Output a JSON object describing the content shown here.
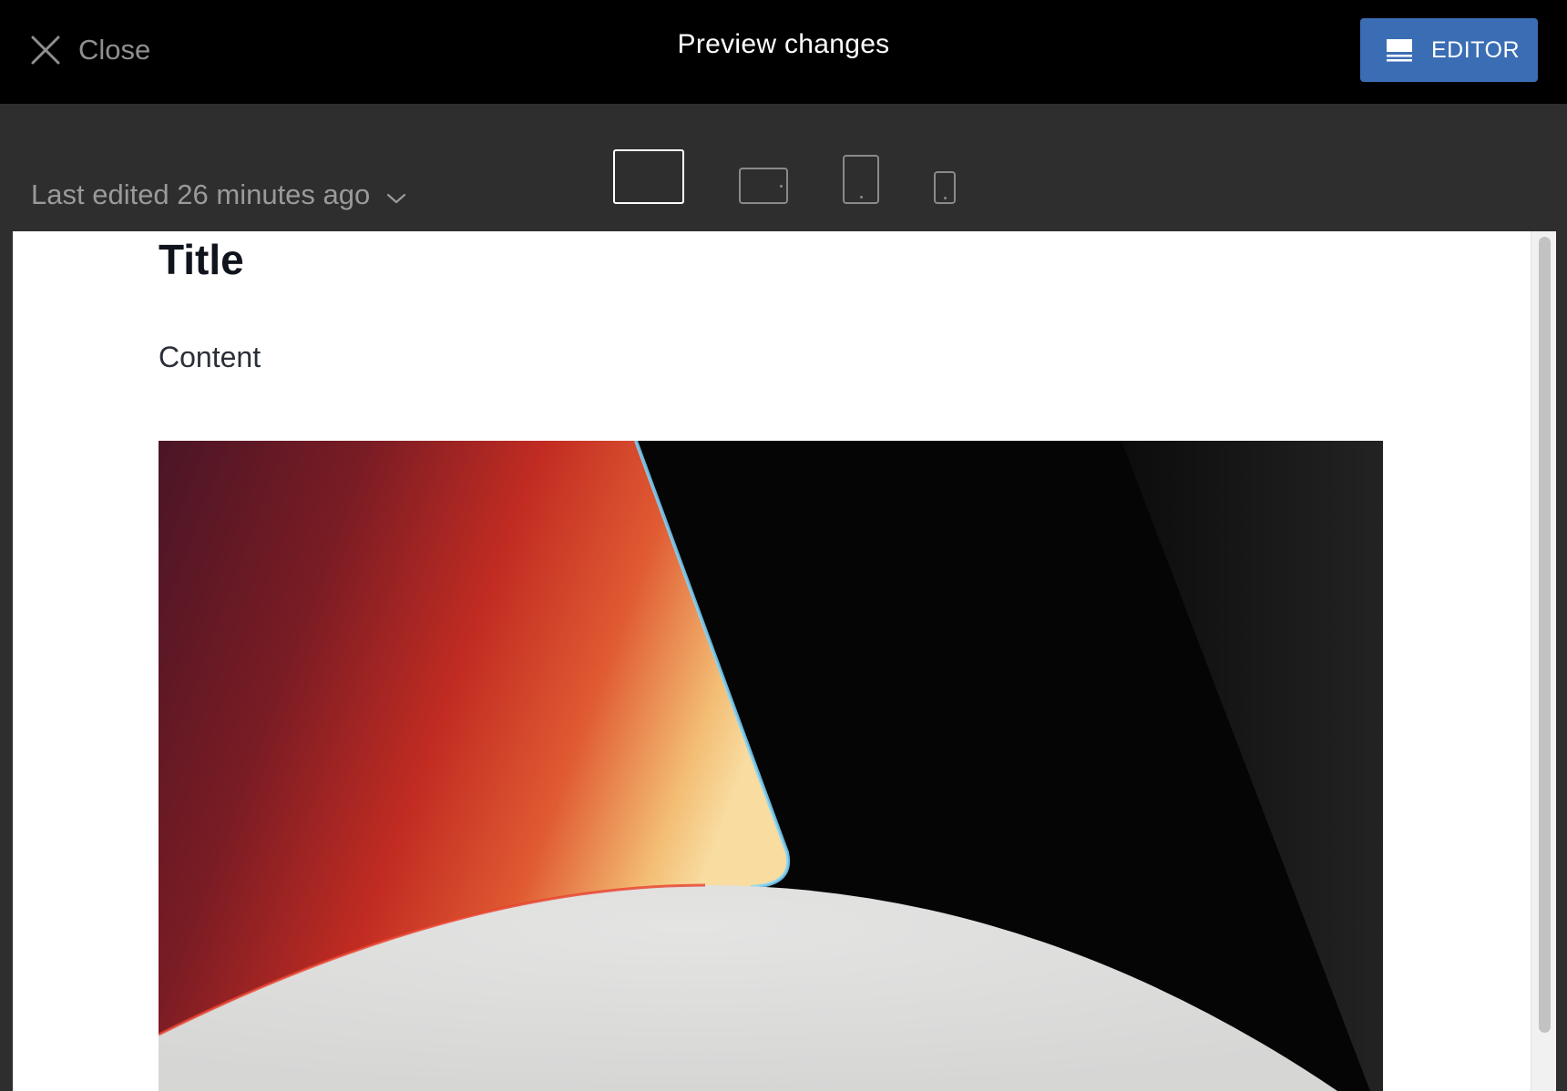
{
  "header": {
    "close_label": "Close",
    "title": "Preview changes",
    "editor_label": "EDITOR",
    "editor_color": "#3b6db4"
  },
  "toolbar": {
    "last_edited": "Last edited 26 minutes ago",
    "devices": [
      {
        "name": "desktop",
        "selected": true
      },
      {
        "name": "tablet-landscape",
        "selected": false
      },
      {
        "name": "tablet-portrait",
        "selected": false
      },
      {
        "name": "mobile",
        "selected": false
      }
    ]
  },
  "preview": {
    "title": "Title",
    "content": "Content",
    "image_icon": "abstract-gradient-image"
  },
  "colors": {
    "topbar": "#000000",
    "toolbar": "#2e2e2e",
    "accent": "#3b6db4"
  }
}
